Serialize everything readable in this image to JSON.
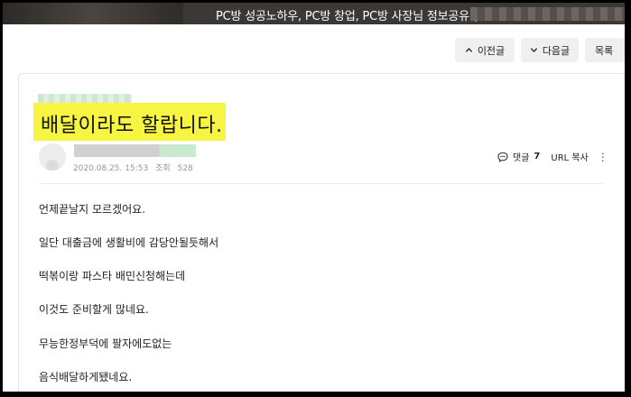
{
  "header": {
    "title": "PC방 성공노하우, PC방 창업, PC방 사장님 정보공유 ("
  },
  "nav": {
    "prev_label": "이전글",
    "next_label": "다음글",
    "list_label": "목록"
  },
  "post": {
    "title": "배달이라도 할랍니다.",
    "date": "2020.08.25. 15:53",
    "views_label": "조회",
    "views": "528",
    "comment_label": "댓글",
    "comment_count": "7",
    "url_copy_label": "URL 복사",
    "more_glyph": "⋮",
    "body": [
      "언제끝날지 모르겠어요.",
      "일단 대출금에 생활비에 감당안될듯해서",
      "떡볶이랑 파스타 배민신청해는데",
      "이것도 준비할게 많네요.",
      "무능한정부덕에 팔자에도없는",
      "음식배달하게됐네요."
    ]
  },
  "icons": {
    "prev": "chevron-up-icon",
    "next": "chevron-down-icon",
    "comment": "comment-bubble-icon",
    "more": "more-vertical-icon"
  },
  "colors": {
    "highlight": "#f6f542",
    "header_bg": "#3b3835",
    "button_bg": "#eff0f2"
  }
}
